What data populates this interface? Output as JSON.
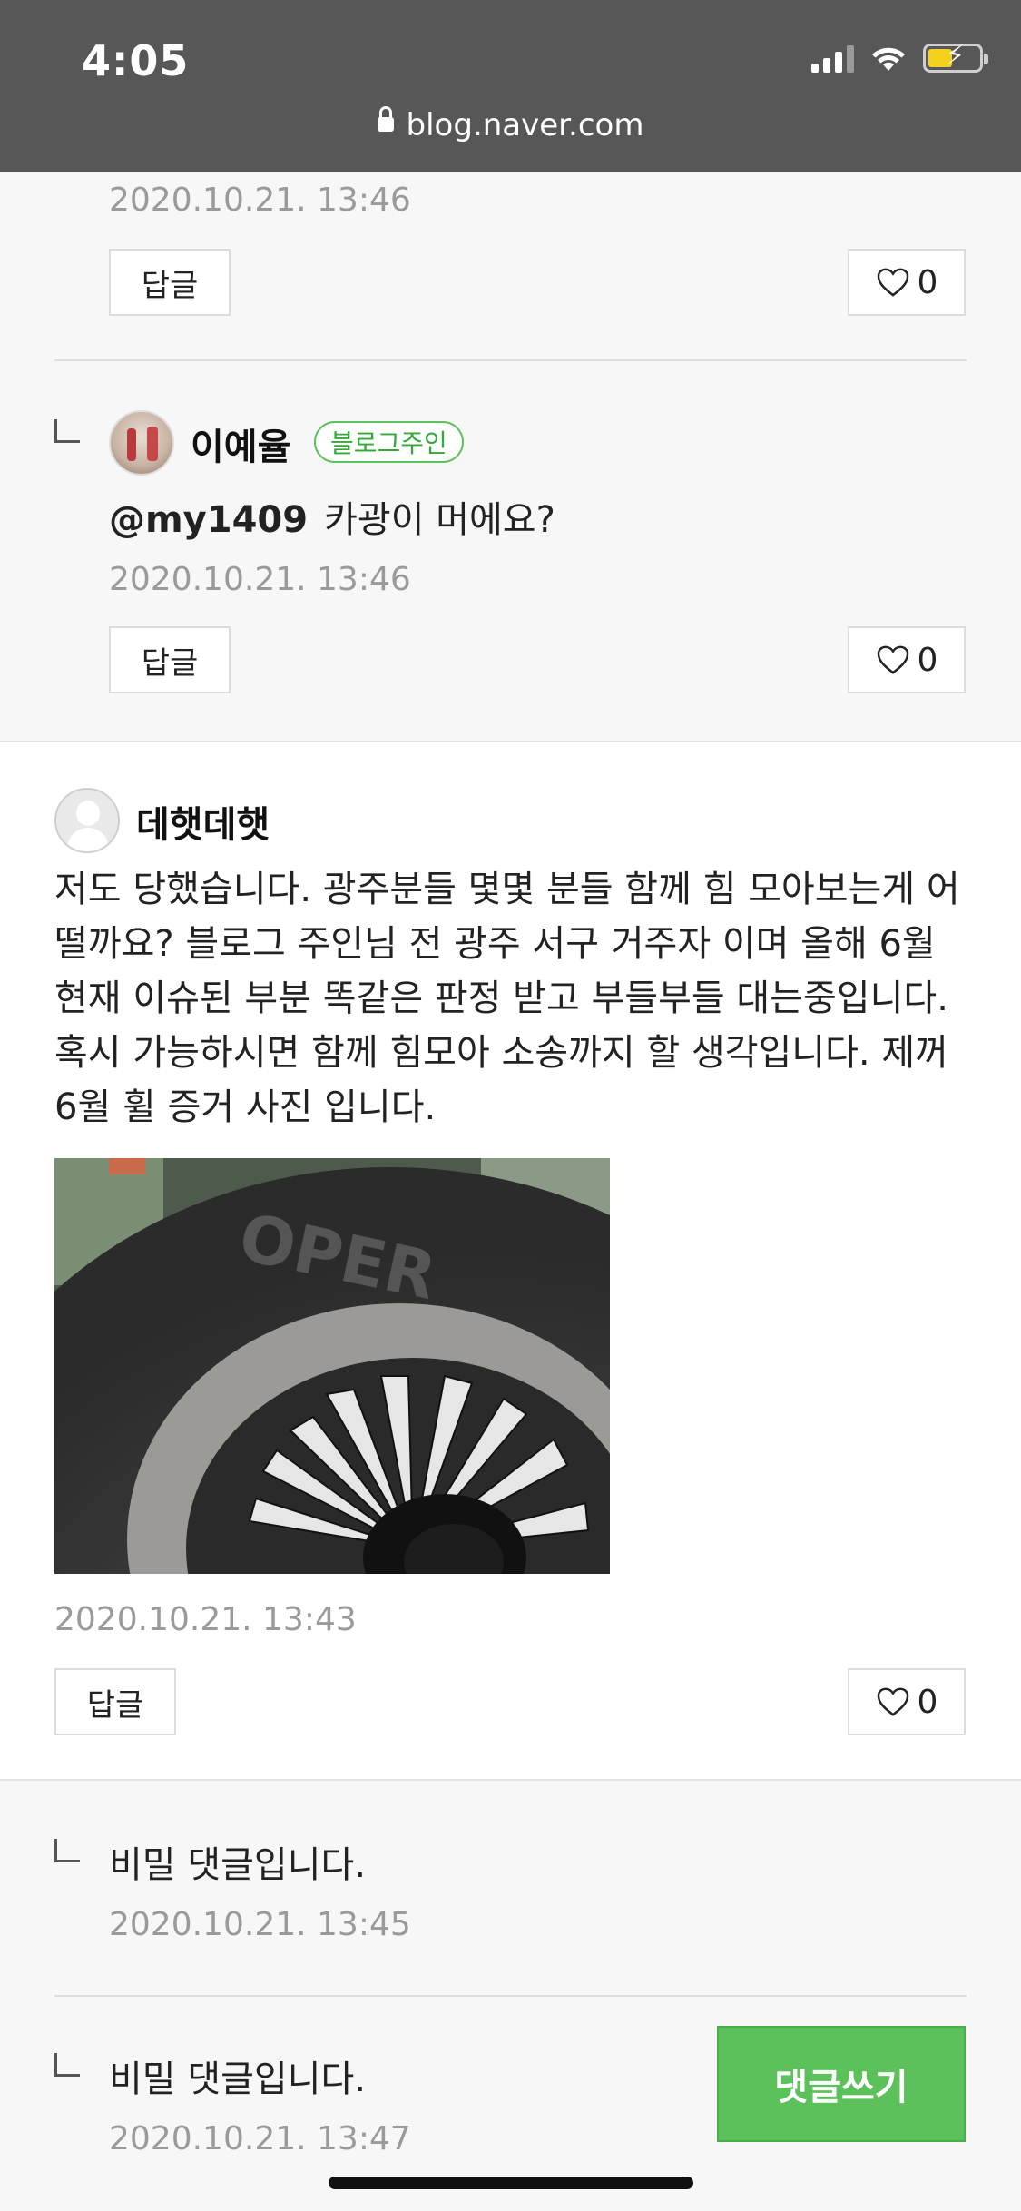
{
  "status_bar": {
    "time": "4:05",
    "url": "blog.naver.com"
  },
  "reply_1": {
    "date": "2020.10.21. 13:46",
    "reply_label": "답글",
    "like_count": "0"
  },
  "reply_2": {
    "nickname": "이예율",
    "badge": "블로그주인",
    "mention": "@my1409",
    "text": "카광이 머에요?",
    "date": "2020.10.21. 13:46",
    "reply_label": "답글",
    "like_count": "0"
  },
  "comment": {
    "nickname": "데햇데햇",
    "body": "저도 당했습니다. 광주분들 몇몇 분들 함께 힘 모아보는게 어떨까요? 블로그 주인님 전 광주 서구 거주자 이며 올해 6월 현재 이슈된 부분 똑같은 판정 받고 부들부들 대는중입니다. 혹시 가능하시면 함께 힘모아 소송까지 할 생각입니다. 제꺼 6월 휠 증거 사진 입니다.",
    "date": "2020.10.21. 13:43",
    "reply_label": "답글",
    "like_count": "0"
  },
  "secret_reply_1": {
    "text": "비밀 댓글입니다.",
    "date": "2020.10.21. 13:45"
  },
  "secret_reply_2": {
    "text": "비밀 댓글입니다.",
    "date": "2020.10.21. 13:47"
  },
  "write_button": "댓글쓰기",
  "colors": {
    "accent": "#5cc15b",
    "status_bar": "#575757"
  }
}
